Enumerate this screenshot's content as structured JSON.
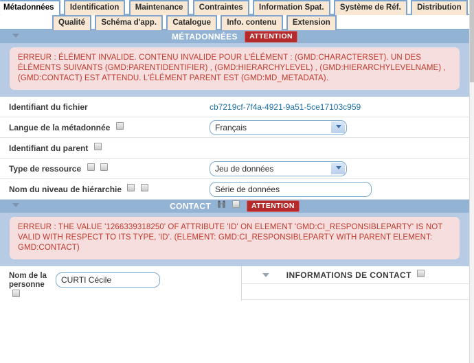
{
  "tabs_row1": [
    {
      "label": "Métadonnées",
      "active": true
    },
    {
      "label": "Identification",
      "active": false
    },
    {
      "label": "Maintenance",
      "active": false
    },
    {
      "label": "Contraintes",
      "active": false
    },
    {
      "label": "Information Spat.",
      "active": false
    },
    {
      "label": "Système de Réf.",
      "active": false
    },
    {
      "label": "Distribution",
      "active": false
    }
  ],
  "tabs_row2": [
    {
      "label": "Qualité"
    },
    {
      "label": "Schéma d'app."
    },
    {
      "label": "Catalogue"
    },
    {
      "label": "Info. contenu"
    },
    {
      "label": "Extension"
    }
  ],
  "metadata_panel": {
    "title": "MÉTADONNÉES",
    "badge": "ATTENTION",
    "error": "ERREUR : ÉLÉMENT INVALIDE. CONTENU INVALIDE POUR L'ÉLÉMENT : (GMD:CHARACTERSET). UN DES ÉLÉMENTS SUIVANTS (GMD:PARENTIDENTIFIER) , (GMD:HIERARCHYLEVEL) , (GMD:HIERARCHYLEVELNAME) , (GMD:CONTACT) EST ATTENDU. L'ÉLÉMENT PARENT EST (GMD:MD_METADATA)."
  },
  "fields": {
    "file_identifier": {
      "label": "Identifiant du fichier",
      "value": "cb7219cf-7f4a-4921-9a51-5ce17103c959"
    },
    "metadata_language": {
      "label": "Langue de la métadonnée",
      "value": "Français",
      "options": [
        "Français"
      ]
    },
    "parent_identifier": {
      "label": "Identifiant du parent",
      "value": ""
    },
    "resource_type": {
      "label": "Type de ressource",
      "value": "Jeu de données",
      "options": [
        "Jeu de données"
      ]
    },
    "hierarchy_level_name": {
      "label": "Nom du niveau de hiérarchie",
      "value": "Série de données"
    }
  },
  "contact_panel": {
    "title": "CONTACT",
    "badge": "ATTENTION",
    "error": "ERREUR : THE VALUE '1266339318250' OF ATTRIBUTE 'ID' ON ELEMENT 'GMD:CI_RESPONSIBLEPARTY' IS NOT VALID WITH RESPECT TO ITS TYPE, 'ID'. (ELEMENT: GMD:CI_RESPONSIBLEPARTY WITH PARENT ELEMENT: GMD:CONTACT)"
  },
  "contact_fields": {
    "person_name": {
      "label": "Nom de la personne",
      "value": "CURTI Cécile"
    },
    "contact_info_title": "INFORMATIONS DE CONTACT"
  },
  "colors": {
    "tab_inactive": "#f7e7d3",
    "tab_border": "#7ba3ce",
    "panel_header": "#93b3d5",
    "panel_body": "#b7cbe4",
    "error_bg": "#f6dede",
    "error_text": "#c0392b",
    "badge_bg": "#b52b2b",
    "link": "#1d6fa5"
  }
}
